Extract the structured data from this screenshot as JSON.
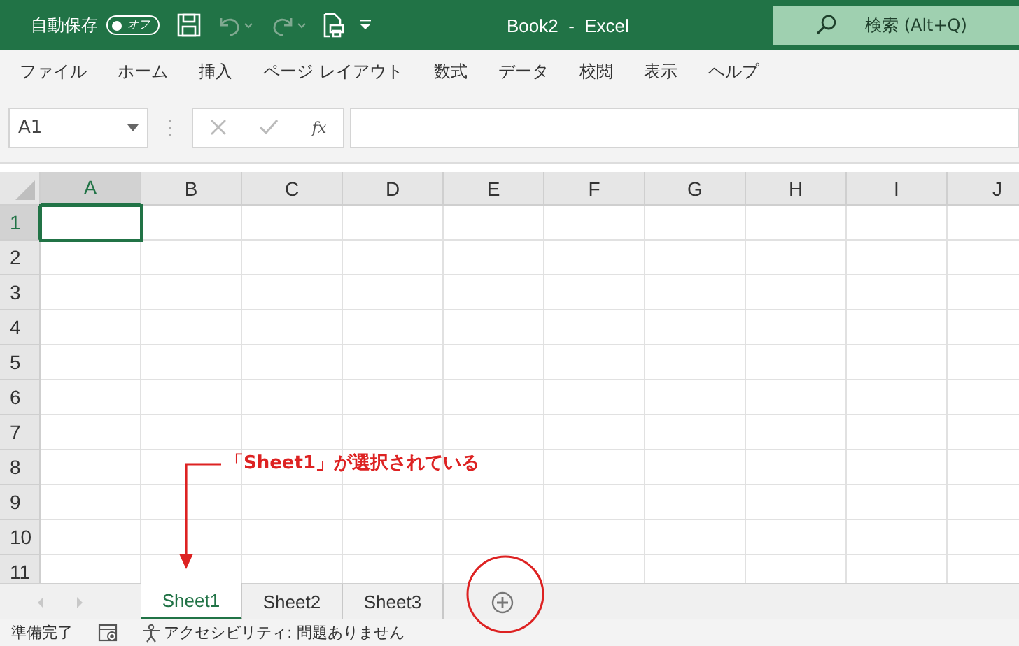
{
  "title_bar": {
    "autosave_label": "自動保存",
    "autosave_toggle": {
      "label": "オフ",
      "on": false
    },
    "title": "Book2  -  Excel",
    "search": {
      "placeholder": "検索 (Alt+Q)"
    }
  },
  "ribbon_tabs": [
    {
      "label": "ファイル"
    },
    {
      "label": "ホーム"
    },
    {
      "label": "挿入"
    },
    {
      "label": "ページ レイアウト"
    },
    {
      "label": "数式"
    },
    {
      "label": "データ"
    },
    {
      "label": "校閲"
    },
    {
      "label": "表示"
    },
    {
      "label": "ヘルプ"
    }
  ],
  "formula_bar": {
    "name_box": "A1",
    "function_label": "fx"
  },
  "sheet": {
    "columns": [
      {
        "label": "A",
        "selected": true
      },
      {
        "label": "B",
        "selected": false
      },
      {
        "label": "C",
        "selected": false
      },
      {
        "label": "D",
        "selected": false
      },
      {
        "label": "E",
        "selected": false
      },
      {
        "label": "F",
        "selected": false
      },
      {
        "label": "G",
        "selected": false
      },
      {
        "label": "H",
        "selected": false
      },
      {
        "label": "I",
        "selected": false
      },
      {
        "label": "J",
        "selected": false
      }
    ],
    "rows": [
      {
        "label": "1",
        "selected": true
      },
      {
        "label": "2",
        "selected": false
      },
      {
        "label": "3",
        "selected": false
      },
      {
        "label": "4",
        "selected": false
      },
      {
        "label": "5",
        "selected": false
      },
      {
        "label": "6",
        "selected": false
      },
      {
        "label": "7",
        "selected": false
      },
      {
        "label": "8",
        "selected": false
      },
      {
        "label": "9",
        "selected": false
      },
      {
        "label": "10",
        "selected": false
      },
      {
        "label": "11",
        "selected": false
      }
    ]
  },
  "sheet_tabs": [
    {
      "label": "Sheet1",
      "selected": true
    },
    {
      "label": "Sheet2",
      "selected": false
    },
    {
      "label": "Sheet3",
      "selected": false
    }
  ],
  "status_bar": {
    "ready": "準備完了",
    "accessibility": "アクセシビリティ: 問題ありません"
  },
  "annotation": {
    "text": "「Sheet1」が選択されている"
  }
}
